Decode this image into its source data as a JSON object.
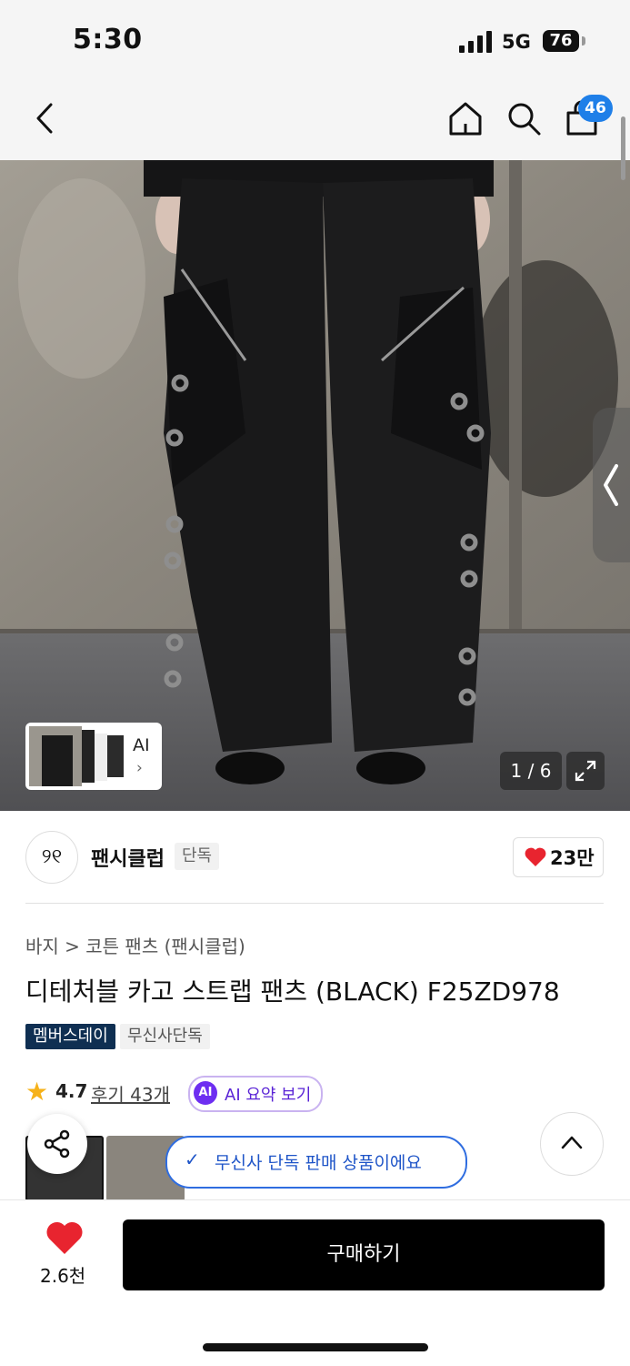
{
  "status_bar": {
    "time": "5:30",
    "network": "5G",
    "battery": "76"
  },
  "nav": {
    "cart_count": "46",
    "icons": [
      "back-icon",
      "home-icon",
      "search-icon",
      "cart-icon"
    ]
  },
  "gallery": {
    "ai_label": "AI",
    "ai_chevron": "›",
    "counter": "1 / 6"
  },
  "brand": {
    "logo_text": "୨୧",
    "name": "팬시클럽",
    "exclusive_tag": "단독",
    "like_count": "23만"
  },
  "product": {
    "breadcrumb": "바지 > 코튼 팬츠 (팬시클럽)",
    "title": "디테처블 카고 스트랩 팬츠 (BLACK) F25ZD978",
    "tags": [
      "멤버스데이",
      "무신사단독"
    ],
    "rating": "4.7",
    "reviews": "후기 43개",
    "ai_badge": "AI",
    "ai_summary": "AI 요약 보기"
  },
  "toast": {
    "check": "✓",
    "text": "무신사 단독 판매 상품이에요"
  },
  "bottom": {
    "wish_count": "2.6천",
    "buy_label": "구매하기"
  },
  "colors": {
    "accent_blue": "#1f7fe8",
    "buy_black": "#000000",
    "heart_red": "#e8242f",
    "member_navy": "#0f2f52",
    "ai_purple": "#6d2ef1"
  }
}
